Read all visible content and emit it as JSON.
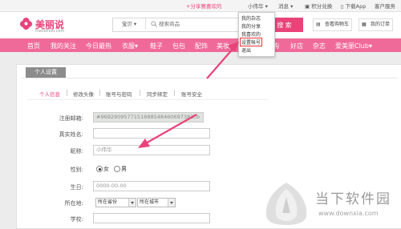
{
  "topbar": {
    "share": "+分享赛喜欢的",
    "user": "小伟华",
    "messages": "消息",
    "points": "积分兑换",
    "download": "下载App",
    "service": "客户服务"
  },
  "logo": {
    "text": "美丽说",
    "subtitle": "meilishuo.com"
  },
  "search": {
    "category": "宝贝",
    "placeholder": "搜索商品",
    "button": "搜 索"
  },
  "header_buttons": {
    "cart": "查看购物车",
    "orders": "我的订单"
  },
  "nav": [
    "首页",
    "我的关注",
    "今日最热",
    "衣服",
    "鞋子",
    "包包",
    "配饰",
    "美妆",
    "家居",
    "购",
    "好店",
    "杂志",
    "爱美丽Club"
  ],
  "dropdown": [
    "我的杂志",
    "我的分享",
    "我喜欢的",
    "设置帐号",
    "退出"
  ],
  "panel": {
    "tab": "个人设置"
  },
  "subtabs": [
    "个人信息",
    "修改头像",
    "账号与密码",
    "同步绑定",
    "账号安全"
  ],
  "form": {
    "email_label": "注册邮箱:",
    "email_value": "#9692909577151688548460697381cb",
    "name_label": "真实姓名:",
    "name_value": "",
    "nick_label": "昵称:",
    "nick_value": "小伟华",
    "gender_label": "性别:",
    "gender_female": "女",
    "gender_male": "男",
    "birthday_label": "生日:",
    "birthday_value": "0000-00-00",
    "location_label": "所在地:",
    "province": "所在省份",
    "city": "所在城市",
    "school_label": "学校:"
  },
  "watermark": {
    "title": "当下软件园",
    "url": "www.downxia.com"
  },
  "colors": {
    "brand": "#e9437a",
    "nav": "#f06a99",
    "arrow": "#e9437a"
  }
}
